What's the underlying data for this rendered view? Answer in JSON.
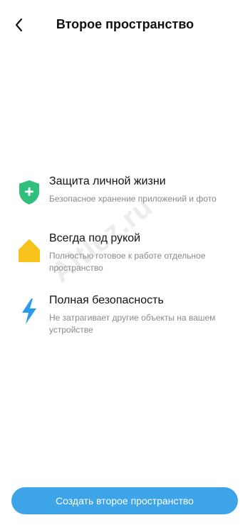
{
  "header": {
    "title": "Второе пространство"
  },
  "features": [
    {
      "title": "Защита личной жизни",
      "description": "Безопасное хранение приложений и фото",
      "icon": "shield-plus-icon",
      "color": "#2fc07e"
    },
    {
      "title": "Всегда под рукой",
      "description": "Полностью готовое к работе отдельное пространство",
      "icon": "home-icon",
      "color": "#f7c21b"
    },
    {
      "title": "Полная безопасность",
      "description": "Не затрагивает другие объекты на вашем устройстве",
      "icon": "lightning-icon",
      "color": "#2a9be8"
    }
  ],
  "watermark": "Altlez.ru",
  "cta": {
    "label": "Создать второе пространство",
    "color": "#3da4e8"
  }
}
